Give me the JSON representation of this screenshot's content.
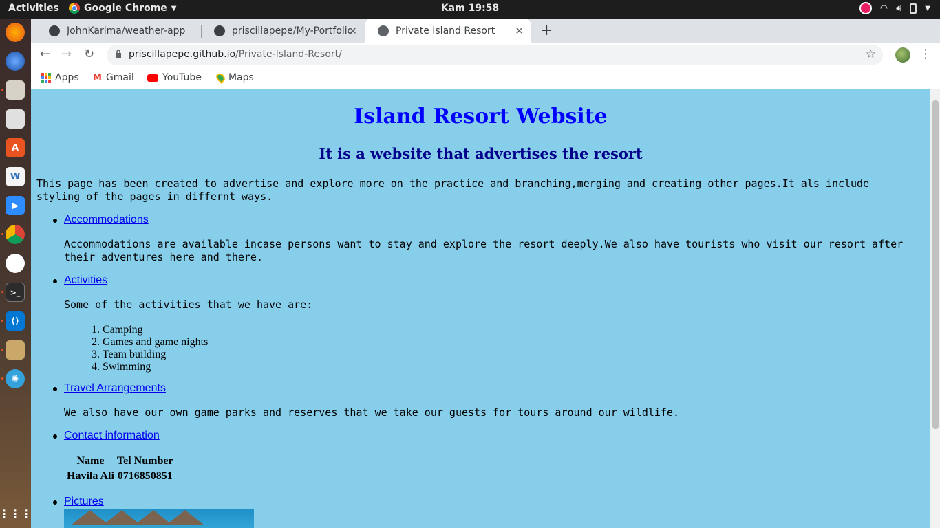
{
  "topbar": {
    "activities": "Activities",
    "app_name": "Google Chrome",
    "clock": "Kam 19:58"
  },
  "tabs": [
    {
      "title": "JohnKarima/weather-app",
      "icon": "github-icon"
    },
    {
      "title": "priscillapepe/My-Portfolio",
      "icon": "github-icon"
    },
    {
      "title": "Private Island Resort",
      "icon": "globe-icon",
      "active": true
    }
  ],
  "address": {
    "host": "priscillapepe.github.io",
    "path": "/Private-Island-Resort/"
  },
  "bookmarks": [
    {
      "label": "Apps",
      "icon": "apps-grid-icon"
    },
    {
      "label": "Gmail",
      "icon": "gmail-icon"
    },
    {
      "label": "YouTube",
      "icon": "youtube-icon"
    },
    {
      "label": "Maps",
      "icon": "maps-pin-icon"
    }
  ],
  "page": {
    "title": "Island Resort Website",
    "subtitle": "It is a website that advertises the resort",
    "intro": "This page has been created to advertise and explore more on the practice and branching,merging and creating other pages.It als include styling of the pages in differnt ways.",
    "sections": {
      "accommodations": {
        "link": "Accommodations",
        "text": "Accommodations are available incase persons want to stay and explore the resort deeply.We also have tourists who visit our resort after their adventures here and there."
      },
      "activities": {
        "link": "Activities",
        "text": "Some of the activities that we have are:",
        "items": [
          "1. Camping",
          "2. Games and game nights",
          "3. Team building",
          "4. Swimming"
        ]
      },
      "travel": {
        "link": "Travel Arrangements",
        "text": "We also have our own game parks and reserves that we take our guests for tours around our wildlife."
      },
      "contact": {
        "link": "Contact information",
        "headers": [
          "Name",
          "Tel Number"
        ],
        "rows": [
          [
            "Havila Ali",
            "0716850851"
          ]
        ]
      },
      "pictures": {
        "link": "Pictures"
      }
    }
  },
  "colors": {
    "page_bg": "#87ceeb",
    "title": "#0000ff",
    "subtitle": "#00008b",
    "link": "#0000ee"
  }
}
